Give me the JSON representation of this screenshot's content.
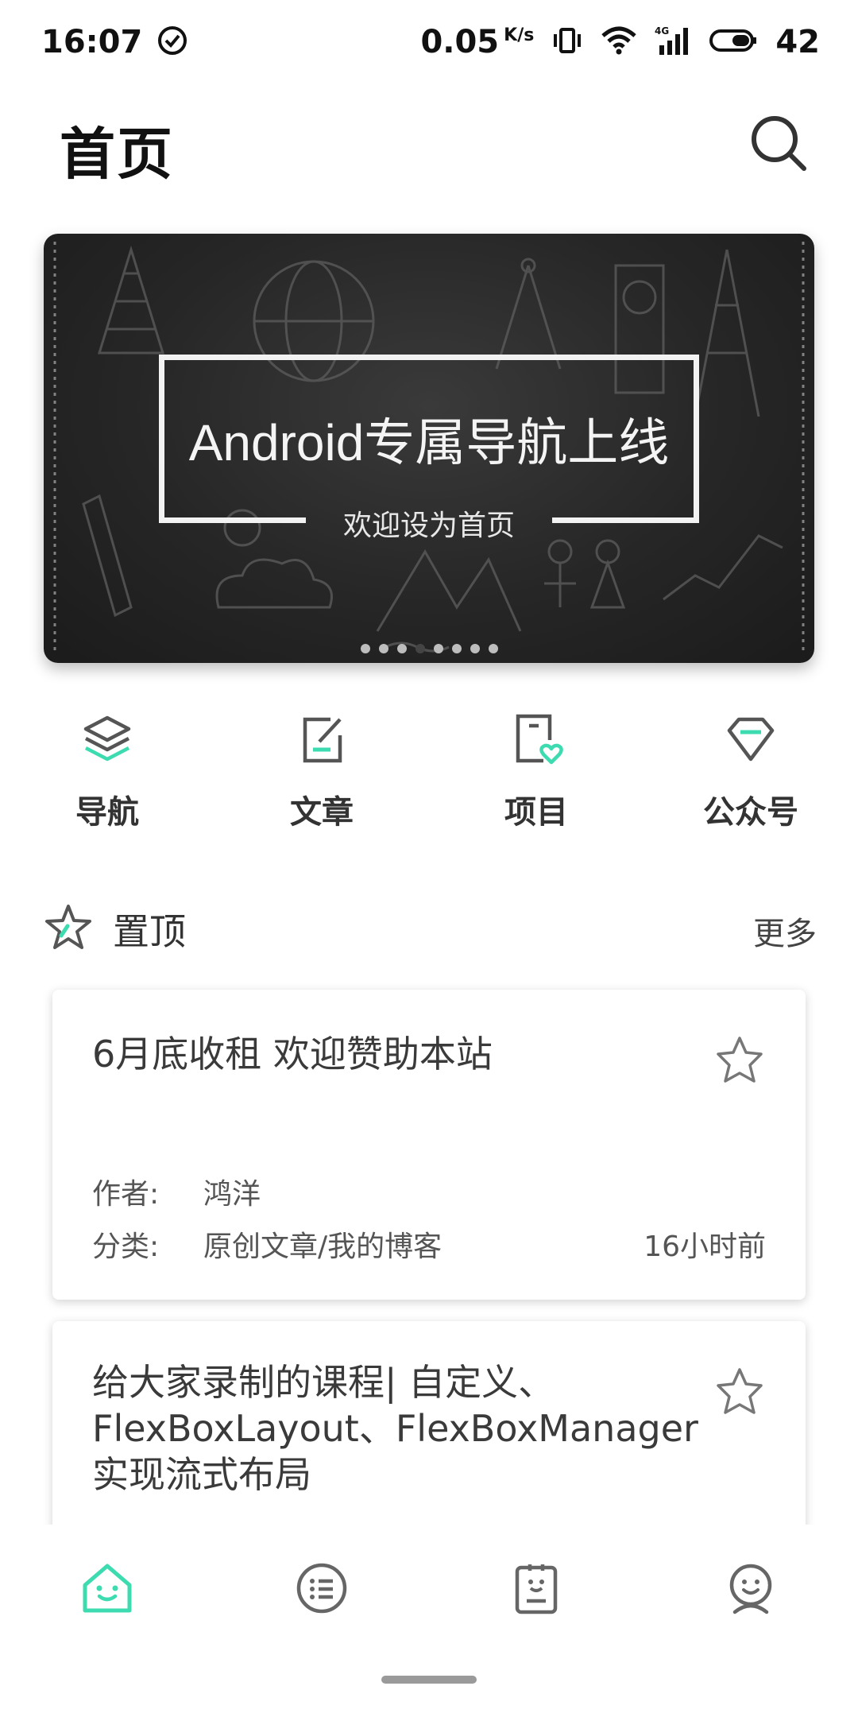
{
  "status_bar": {
    "time": "16:07",
    "net_speed": "0.05",
    "net_speed_unit": "K/s",
    "network_type": "4G",
    "battery_level": "42"
  },
  "header": {
    "title": "首页",
    "search_icon": "search-icon"
  },
  "banner": {
    "title": "Android专属导航上线",
    "subtitle": "欢迎设为首页",
    "page_count": 8,
    "active_index": 3
  },
  "quick_nav": [
    {
      "label": "导航",
      "icon": "layers-icon"
    },
    {
      "label": "文章",
      "icon": "edit-note-icon"
    },
    {
      "label": "项目",
      "icon": "phone-heart-icon"
    },
    {
      "label": "公众号",
      "icon": "diamond-icon"
    }
  ],
  "section": {
    "title": "置顶",
    "more": "更多"
  },
  "cards": [
    {
      "title": "6月底收租 欢迎赞助本站",
      "author_label": "作者:",
      "author": "鸿洋",
      "category_label": "分类:",
      "category": "原创文章/我的博客",
      "time": "16小时前"
    },
    {
      "title": "给大家录制的课程| 自定义、FlexBoxLayout、FlexBoxManager实现流式布局"
    }
  ],
  "bottom_nav": [
    {
      "icon": "home-icon",
      "active": true
    },
    {
      "icon": "list-icon",
      "active": false
    },
    {
      "icon": "clipboard-icon",
      "active": false
    },
    {
      "icon": "profile-icon",
      "active": false
    }
  ],
  "colors": {
    "accent": "#3ddbb0",
    "icon_gray": "#555555"
  }
}
